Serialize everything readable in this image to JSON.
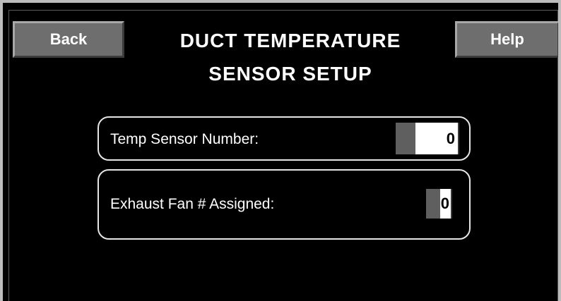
{
  "header": {
    "back_label": "Back",
    "help_label": "Help",
    "title_line1": "DUCT TEMPERATURE",
    "title_line2": "SENSOR SETUP"
  },
  "settings": [
    {
      "label": "Temp Sensor Number:",
      "value": "0"
    },
    {
      "label": "Exhaust Fan # Assigned:",
      "value": "0"
    }
  ],
  "colors": {
    "background": "#000000",
    "button_face": "#6e6e6e",
    "text": "#ffffff",
    "field_value_bg": "#ffffff"
  }
}
